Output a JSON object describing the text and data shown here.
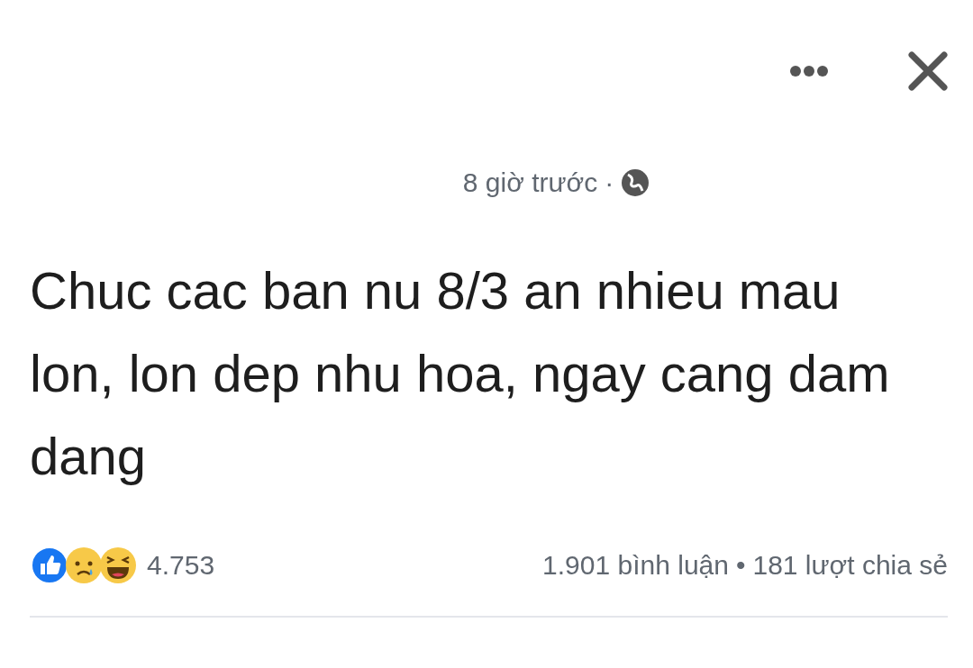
{
  "post": {
    "time": "8 giờ trước",
    "time_separator": "·",
    "text": "Chuc cac ban nu 8/3 an nhieu mau lon, lon dep nhu hoa, ngay cang dam dang"
  },
  "stats": {
    "reactions": [
      {
        "kind": "like"
      },
      {
        "kind": "sad"
      },
      {
        "kind": "haha"
      }
    ],
    "reaction_count": "4.753",
    "comments": "1.901 bình luận",
    "separator": "•",
    "shares": "181 lượt chia sẻ"
  }
}
